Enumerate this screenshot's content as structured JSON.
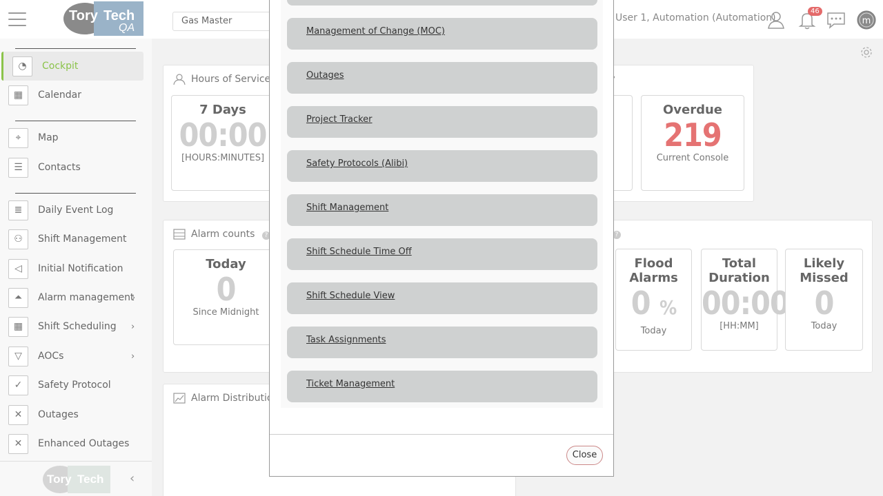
{
  "header": {
    "site_select": "Gas Master",
    "user_name": "User 1, Automation (Automation)",
    "notification_count": "46",
    "logo_text": "Tory Tech",
    "logo_suffix": "QA"
  },
  "sidebar": {
    "items": [
      {
        "label": "Cockpit",
        "icon": "gauge-icon"
      },
      {
        "label": "Calendar",
        "icon": "calendar-icon"
      },
      {
        "label": "Map",
        "icon": "map-pin-icon"
      },
      {
        "label": "Contacts",
        "icon": "contacts-icon"
      },
      {
        "label": "Daily Event Log",
        "icon": "log-icon"
      },
      {
        "label": "Shift Management",
        "icon": "people-icon"
      },
      {
        "label": "Initial Notification",
        "icon": "megaphone-icon"
      },
      {
        "label": "Alarm management",
        "icon": "alarm-icon",
        "arrow": "›"
      },
      {
        "label": "Shift Scheduling",
        "icon": "schedule-icon",
        "arrow": "›"
      },
      {
        "label": "AOCs",
        "icon": "warning-icon",
        "arrow": "›"
      },
      {
        "label": "Safety Protocol",
        "icon": "shield-check-icon"
      },
      {
        "label": "Outages",
        "icon": "tools-icon"
      },
      {
        "label": "Enhanced Outages",
        "icon": "tools-icon"
      }
    ],
    "footer_logo": "Tory Tech",
    "collapse_icon": "‹"
  },
  "main": {
    "hours_card": {
      "title": "Hours of Service",
      "tile": {
        "title": "7 Days",
        "value": "00:00",
        "sub": "[HOURS:MINUTES]"
      }
    },
    "summary_card": {
      "title_fragment": "ary",
      "tile": {
        "title": "Overdue",
        "value": "219",
        "sub": "Current Console"
      }
    },
    "alarm_counts_card": {
      "title": "Alarm counts",
      "today_tile": {
        "title": "Today",
        "value": "0",
        "sub": "Since Midnight"
      },
      "flood_tile": {
        "title": "Flood Alarms",
        "value": "0",
        "unit": "%",
        "sub": "Today"
      },
      "duration_tile": {
        "title": "Total Duration",
        "value": "00:00",
        "sub": "[HH:MM]"
      },
      "missed_tile": {
        "title": "Likely Missed",
        "value": "0",
        "sub": "Today"
      }
    },
    "distribution_card": {
      "title": "Alarm Distribution"
    }
  },
  "modal": {
    "items": [
      "Management of Change (MOC)",
      "Outages",
      "Project Tracker",
      "Safety Protocols (Alibi)",
      "Shift Management",
      "Shift Schedule Time Off",
      "Shift Schedule View",
      "Task Assignments",
      "Ticket Management"
    ],
    "close_label": "Close"
  },
  "colors": {
    "accent_green": "#8bc34a",
    "overdue_red": "#e57373",
    "modal_button": "#cfd1d1"
  }
}
